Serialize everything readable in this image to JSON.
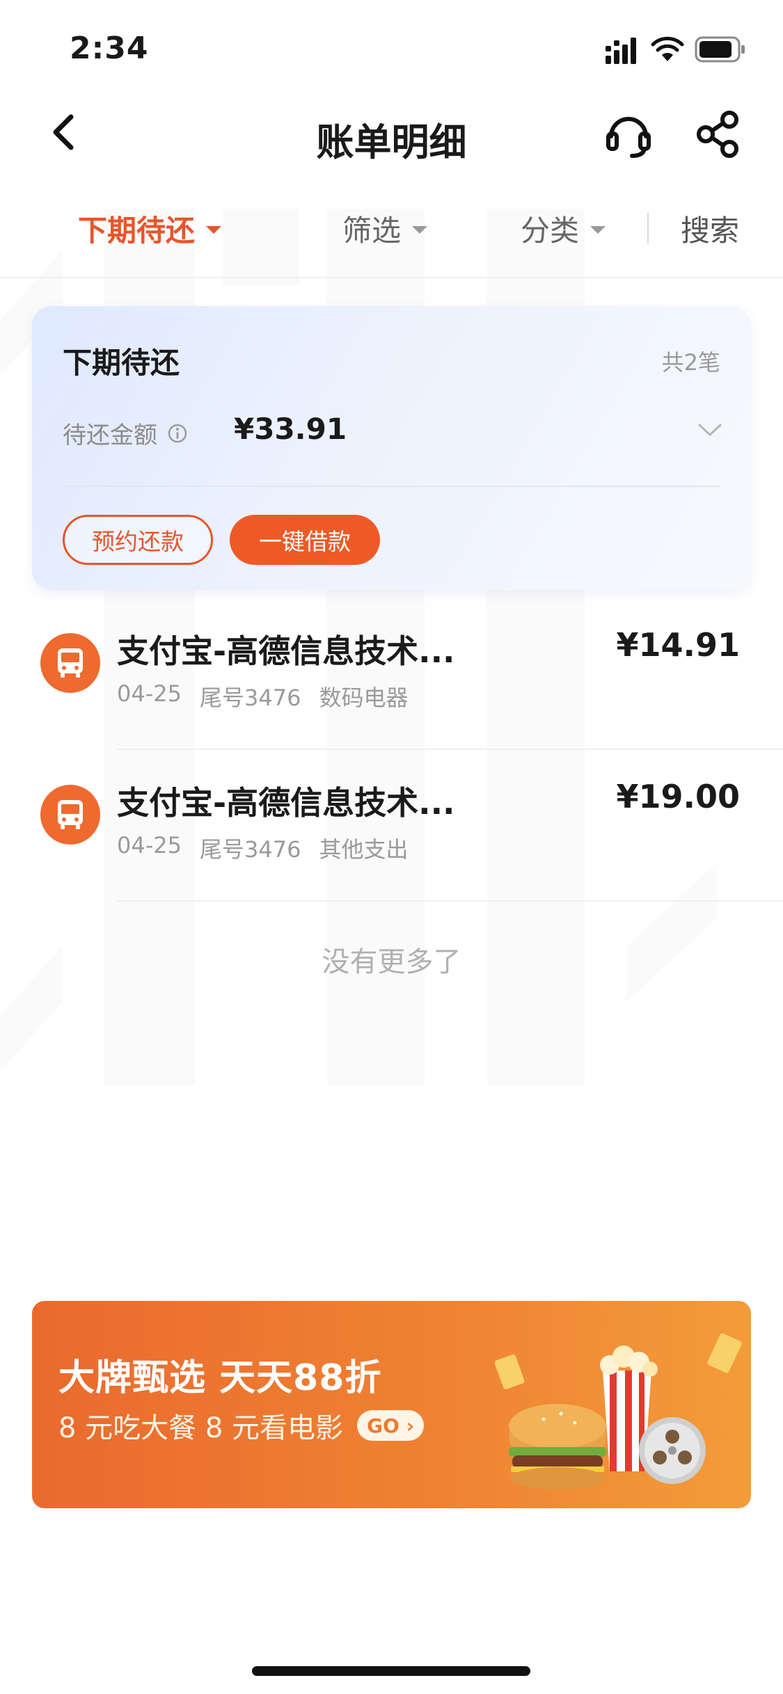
{
  "status_bar": {
    "time": "2:34"
  },
  "nav": {
    "title": "账单明细"
  },
  "filters": {
    "tabs": [
      {
        "label": "下期待还",
        "active": true
      },
      {
        "label": "筛选",
        "active": false
      },
      {
        "label": "分类",
        "active": false
      }
    ],
    "search_label": "搜索"
  },
  "summary": {
    "title": "下期待还",
    "count": "共2笔",
    "amount_label": "待还金额",
    "amount": "¥33.91",
    "reserve_button": "预约还款",
    "borrow_button": "一键借款"
  },
  "bills": [
    {
      "name": "支付宝-高德信息技术...",
      "date": "04-25",
      "card": "尾号3476",
      "category": "数码电器",
      "amount": "¥14.91"
    },
    {
      "name": "支付宝-高德信息技术...",
      "date": "04-25",
      "card": "尾号3476",
      "category": "其他支出",
      "amount": "¥19.00"
    }
  ],
  "list_footer": "没有更多了",
  "promo": {
    "title": "大牌甄选 天天88折",
    "subtitle": "8 元吃大餐  8 元看电影",
    "go_label": "GO ›"
  },
  "colors": {
    "accent": "#e8552a",
    "card_bg": "#e6edfd"
  }
}
